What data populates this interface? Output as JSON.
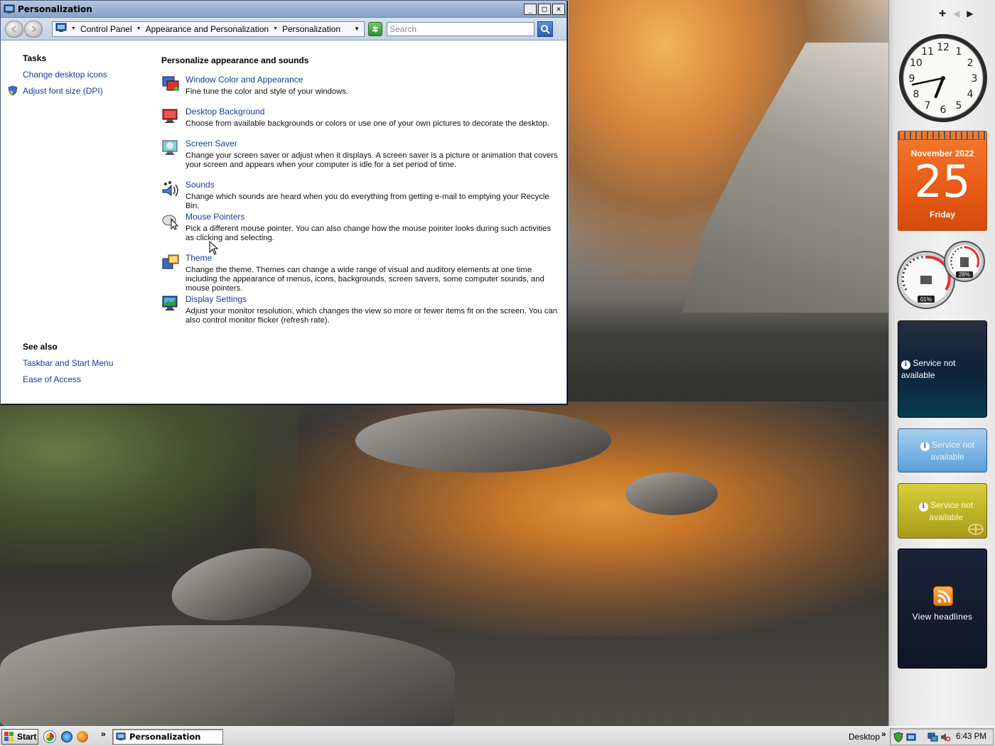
{
  "window": {
    "title": "Personalization",
    "controls": {
      "minimize": "_",
      "maximize": "□",
      "close": "✕"
    }
  },
  "nav": {
    "breadcrumbs": [
      "Control Panel",
      "Appearance and Personalization",
      "Personalization"
    ],
    "search_placeholder": "Search"
  },
  "tasks": {
    "heading": "Tasks",
    "links": [
      "Change desktop icons",
      "Adjust font size (DPI)"
    ]
  },
  "see_also": {
    "heading": "See also",
    "links": [
      "Taskbar and Start Menu",
      "Ease of Access"
    ]
  },
  "main": {
    "heading": "Personalize appearance and sounds",
    "items": [
      {
        "icon": "window-color-icon",
        "title": "Window Color and Appearance",
        "description": "Fine tune the color and style of your windows."
      },
      {
        "icon": "desktop-background-icon",
        "title": "Desktop Background",
        "description": "Choose from available backgrounds or colors or use one of your own pictures to decorate the desktop."
      },
      {
        "icon": "screen-saver-icon",
        "title": "Screen Saver",
        "description": "Change your screen saver or adjust when it displays. A screen saver is a picture or animation that covers your screen and appears when your computer is idle for a set period of time."
      },
      {
        "icon": "sounds-icon",
        "title": "Sounds",
        "description": "Change which sounds are heard when you do everything from getting e-mail to emptying your Recycle Bin."
      },
      {
        "icon": "mouse-pointers-icon",
        "title": "Mouse Pointers",
        "description": "Pick a different mouse pointer. You can also change how the mouse pointer looks during such activities as clicking and selecting."
      },
      {
        "icon": "theme-icon",
        "title": "Theme",
        "description": "Change the theme. Themes can change a wide range of visual and auditory elements at one time including the appearance of menus, icons, backgrounds, screen savers, some computer sounds, and mouse pointers."
      },
      {
        "icon": "display-settings-icon",
        "title": "Display Settings",
        "description": "Adjust your monitor resolution, which changes the view so more or fewer items fit on the screen. You can also control monitor flicker (refresh rate)."
      }
    ]
  },
  "sidebar": {
    "clock": {
      "numerals": [
        "12",
        "1",
        "2",
        "3",
        "4",
        "5",
        "6",
        "7",
        "8",
        "9",
        "10",
        "11"
      ],
      "hour": 6,
      "minute": 43
    },
    "calendar": {
      "month": "November 2022",
      "day": "25",
      "weekday": "Friday"
    },
    "cpu_meter": {
      "cpu_percent": "01%",
      "memory_percent": "28%"
    },
    "weather": {
      "message": "Service not available"
    },
    "stocks": {
      "message": "Service not available"
    },
    "world_map": {
      "message": "Service not available"
    },
    "feeds": {
      "label": "View headlines"
    }
  },
  "taskbar": {
    "start_label": "Start",
    "quicklaunch_chevron": "»",
    "task_button": "Personalization",
    "desktop_toolbar": "Desktop",
    "toolbar_chevron": "»",
    "time": "6:43 PM"
  },
  "colors": {
    "link": "#1a3a9a",
    "titlebar": "#9db2d3",
    "calendar": "#e65a14"
  }
}
